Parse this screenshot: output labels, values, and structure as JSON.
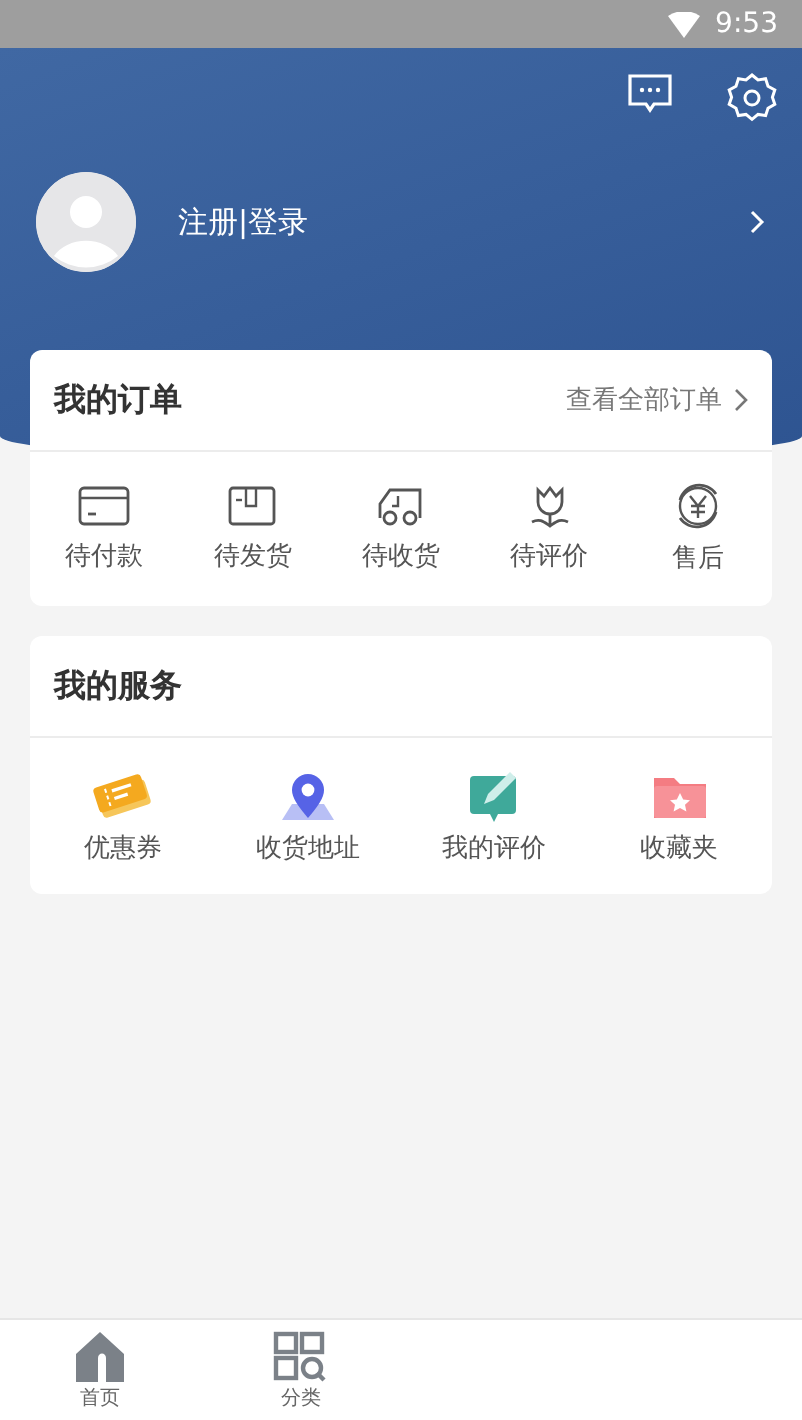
{
  "status_bar": {
    "time": "9:53"
  },
  "profile": {
    "login_label": "注册|登录"
  },
  "orders": {
    "title": "我的订单",
    "view_all": "查看全部订单",
    "items": [
      {
        "kind": "card",
        "label": "待付款"
      },
      {
        "kind": "box",
        "label": "待发货"
      },
      {
        "kind": "truck",
        "label": "待收货"
      },
      {
        "kind": "flower",
        "label": "待评价"
      },
      {
        "kind": "yen",
        "label": "售后"
      }
    ]
  },
  "services": {
    "title": "我的服务",
    "items": [
      {
        "kind": "coupon",
        "label": "优惠券"
      },
      {
        "kind": "pin",
        "label": "收货地址"
      },
      {
        "kind": "review",
        "label": "我的评价"
      },
      {
        "kind": "folder",
        "label": "收藏夹"
      }
    ]
  },
  "bottom_nav": [
    {
      "kind": "home",
      "label": "首页",
      "selected": false
    },
    {
      "kind": "grid",
      "label": "分类",
      "selected": false
    }
  ]
}
